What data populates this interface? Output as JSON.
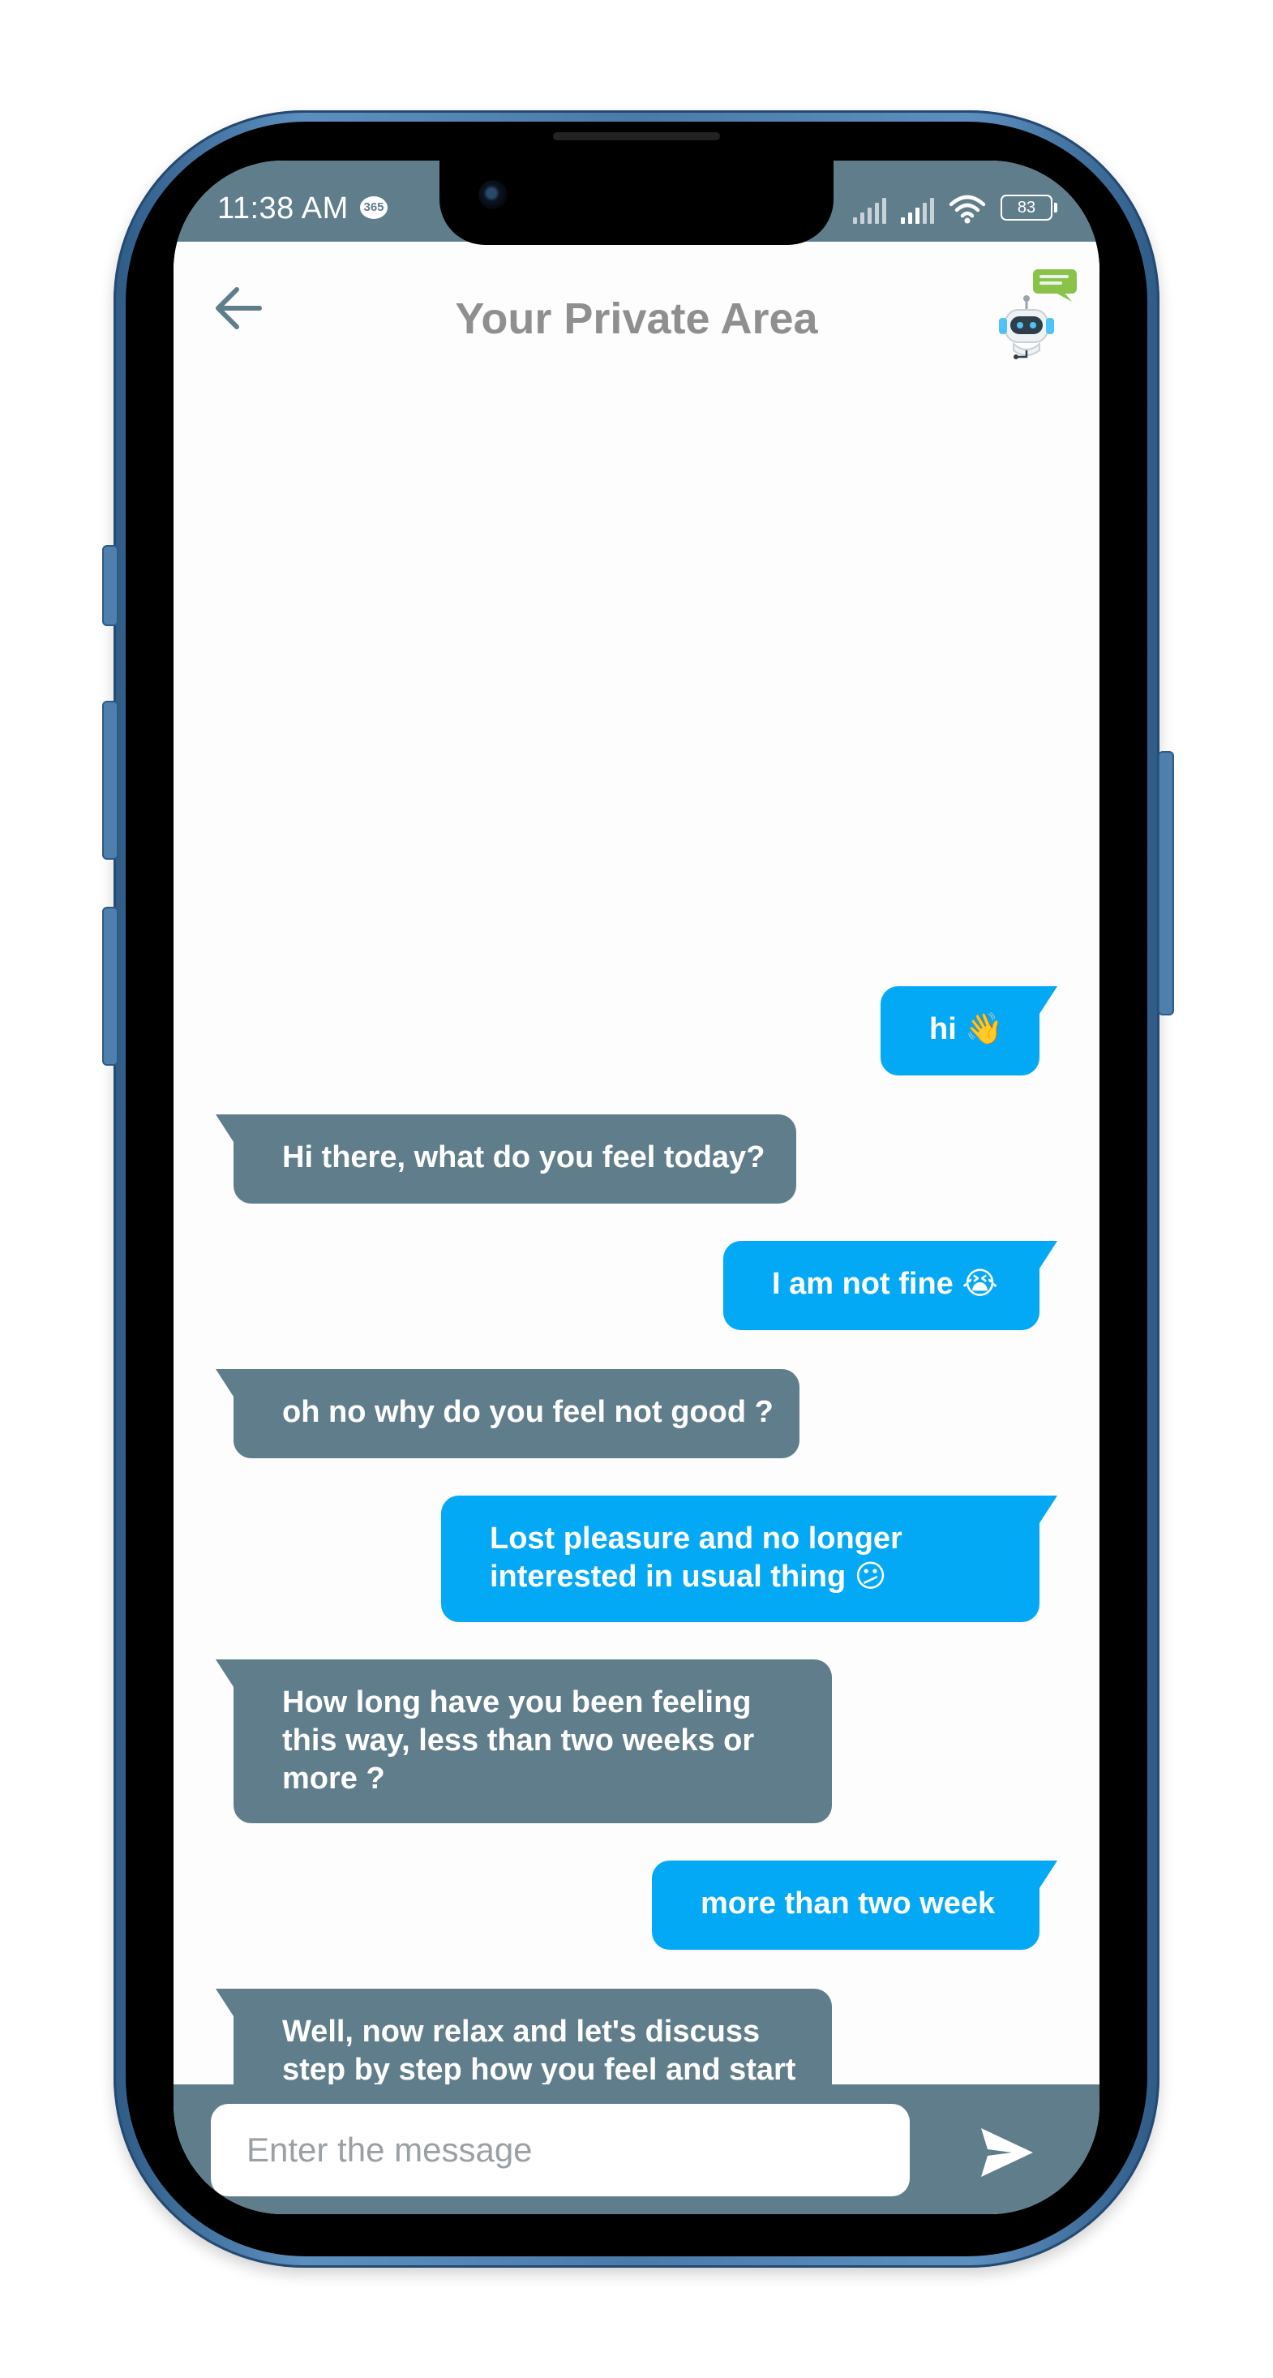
{
  "status_bar": {
    "time": "11:38 AM",
    "badge": "365",
    "battery": "83"
  },
  "header": {
    "title": "Your Private Area",
    "back_icon": "arrow-left-icon",
    "bot_icon": "chatbot-robot-icon"
  },
  "messages": [
    {
      "sender": "user",
      "text": "hi 👋"
    },
    {
      "sender": "bot",
      "text": "Hi there, what do you feel today?"
    },
    {
      "sender": "user",
      "text": "I am not fine 😭"
    },
    {
      "sender": "bot",
      "text": "oh no why do you feel not good ?"
    },
    {
      "sender": "user",
      "text": "Lost pleasure and no longer\ninterested in usual thing 😕"
    },
    {
      "sender": "bot",
      "text": "How long have you been feeling\nthis way, less than two weeks or\nmore ?"
    },
    {
      "sender": "user",
      "text": "more than two week"
    },
    {
      "sender": "bot",
      "text": "Well, now relax and let's discuss\nstep by step how you feel and start\nwith:\nTalking about your mood. Do you\nfeel constant sadness ?"
    }
  ],
  "composer": {
    "placeholder": "Enter the message",
    "value": "",
    "send_icon": "send-icon"
  },
  "colors": {
    "user_bubble": "#03a9f4",
    "bot_bubble": "#607d8b",
    "status_bar": "#607d8b",
    "title_text": "#8f8f8f",
    "phone_frame": "#4a7aa8"
  }
}
